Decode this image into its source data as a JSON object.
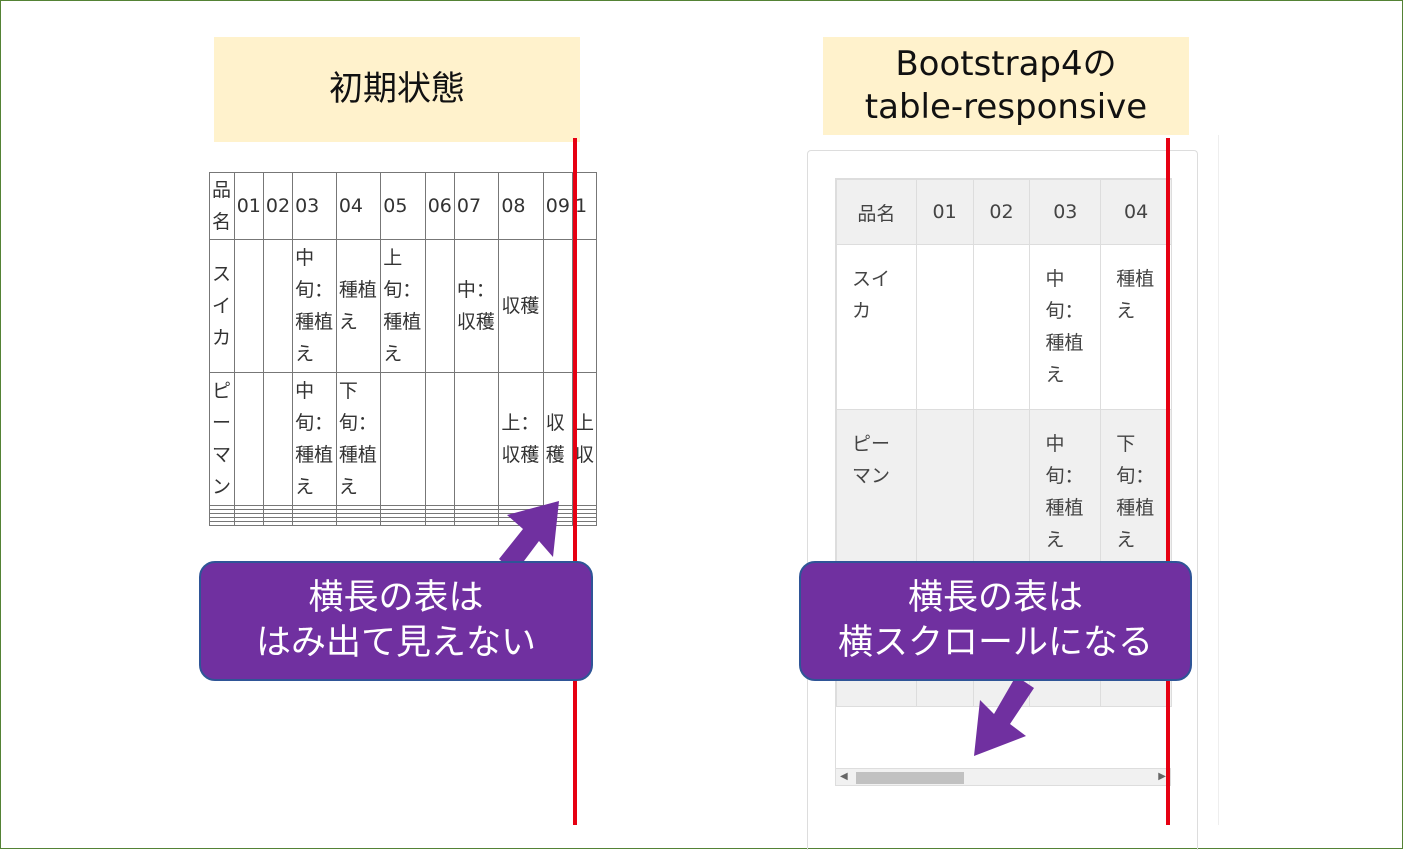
{
  "left_panel": {
    "title": "初期状態",
    "headers": [
      "品名",
      "01",
      "02",
      "03",
      "04",
      "05",
      "06",
      "07",
      "08",
      "09",
      "1"
    ],
    "rows": [
      [
        "スイカ",
        "",
        "",
        "中旬：種植え",
        "種植え",
        "上旬：種植え",
        "",
        "中：収穫",
        "収穫",
        "",
        ""
      ],
      [
        "ピーマン",
        "",
        "",
        "中旬：種植え",
        "下旬：種植え",
        "",
        "",
        "",
        "上：収穫",
        "収穫",
        "上収"
      ]
    ],
    "callout": [
      "横長の表は",
      "はみ出て見えない"
    ]
  },
  "right_panel": {
    "title_line1": "Bootstrap4の",
    "title_line2": "table-responsive",
    "headers": [
      "品名",
      "01",
      "02",
      "03",
      "04"
    ],
    "rows": [
      [
        "スイカ",
        "",
        "",
        "中旬：種植え",
        "種植え"
      ],
      [
        "ピーマン",
        "",
        "",
        "中旬：種植え",
        "下旬：種植え"
      ]
    ],
    "callout": [
      "横長の表は",
      "横スクロールになる"
    ],
    "scroll_left_icon": "triangle-left-icon",
    "scroll_right_icon": "triangle-right-icon"
  },
  "colors": {
    "frame": "#548235",
    "title_bg": "#fff2cc",
    "callout_bg": "#7030a0",
    "callout_border": "#2f5597",
    "red_line": "#e60012"
  }
}
